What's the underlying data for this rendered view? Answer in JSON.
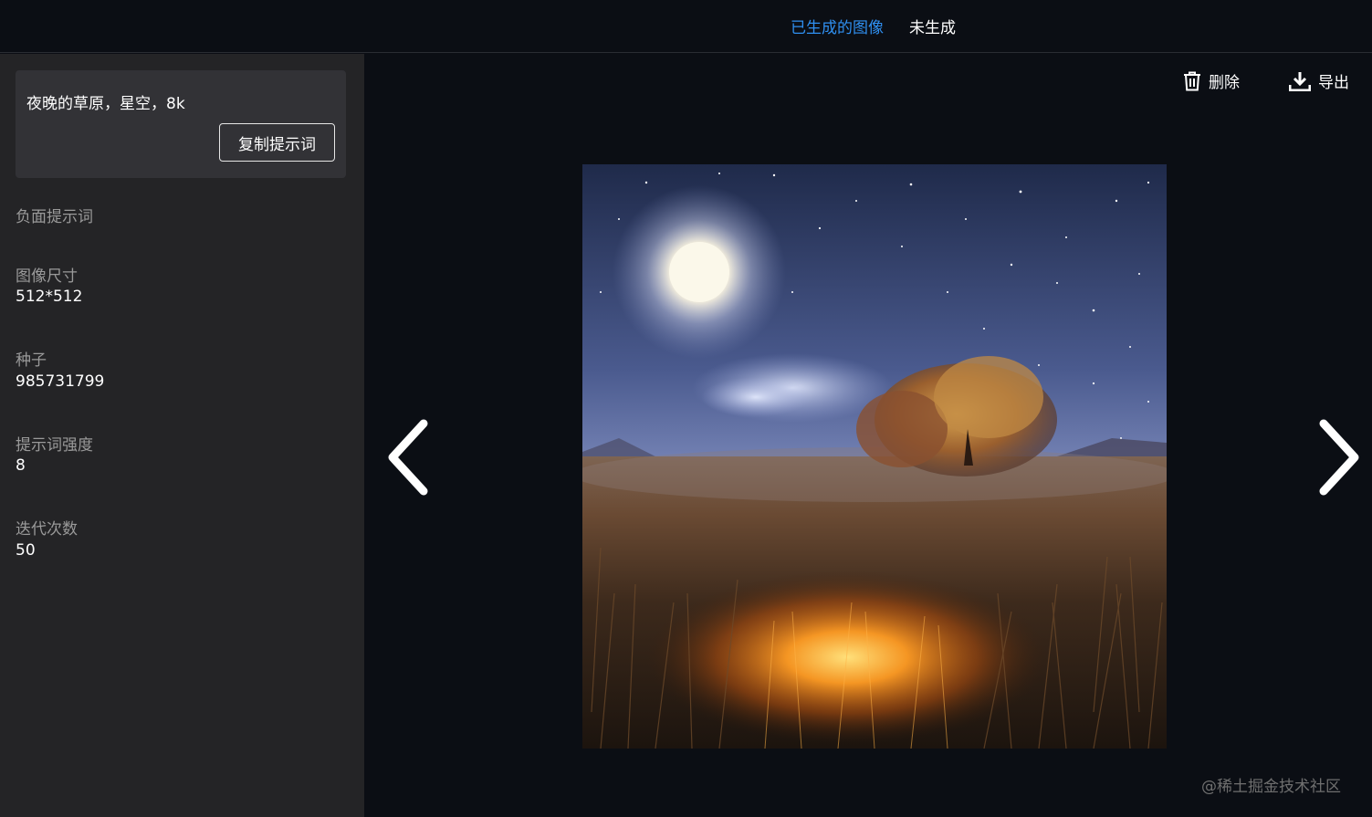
{
  "tabs": {
    "generated": "已生成的图像",
    "not_generated": "未生成"
  },
  "prompt": {
    "text": "夜晚的草原，星空，8k",
    "copy_label": "复制提示词"
  },
  "fields": {
    "negative_prompt_label": "负面提示词",
    "size_label": "图像尺寸",
    "size_value": "512*512",
    "seed_label": "种子",
    "seed_value": "985731799",
    "cfg_label": "提示词强度",
    "cfg_value": "8",
    "steps_label": "迭代次数",
    "steps_value": "50"
  },
  "toolbar": {
    "delete_label": "删除",
    "export_label": "导出"
  },
  "watermark": "@稀土掘金技术社区",
  "colors": {
    "accent": "#2f8ff0",
    "background": "#0b0e14",
    "sidebar": "#242426"
  },
  "icons": [
    "trash-icon",
    "download-icon",
    "chevron-left-icon",
    "chevron-right-icon"
  ]
}
